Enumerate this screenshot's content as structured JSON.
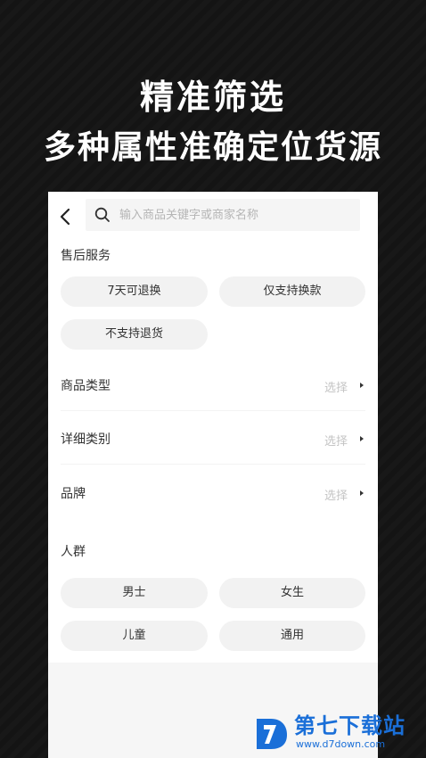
{
  "promo": {
    "line1": "精准筛选",
    "line2": "多种属性准确定位货源"
  },
  "search": {
    "placeholder": "输入商品关键字或商家名称"
  },
  "after_sales": {
    "title": "售后服务",
    "options": [
      "7天可退换",
      "仅支持换款",
      "不支持退货"
    ]
  },
  "rows": [
    {
      "label": "商品类型",
      "value": "选择"
    },
    {
      "label": "详细类别",
      "value": "选择"
    },
    {
      "label": "品牌",
      "value": "选择"
    }
  ],
  "crowd": {
    "title": "人群",
    "options": [
      "男士",
      "女生",
      "儿童",
      "通用"
    ]
  },
  "watermark": {
    "name": "第七下载站",
    "url": "www.d7down.com"
  },
  "colors": {
    "background": "#121212",
    "chip_bg": "#f2f2f2",
    "placeholder": "#b5b5b5",
    "brand_blue": "#1a6fd8"
  },
  "icons": {
    "back": "chevron-left-icon",
    "search": "search-icon",
    "row_arrow": "caret-right-icon"
  }
}
